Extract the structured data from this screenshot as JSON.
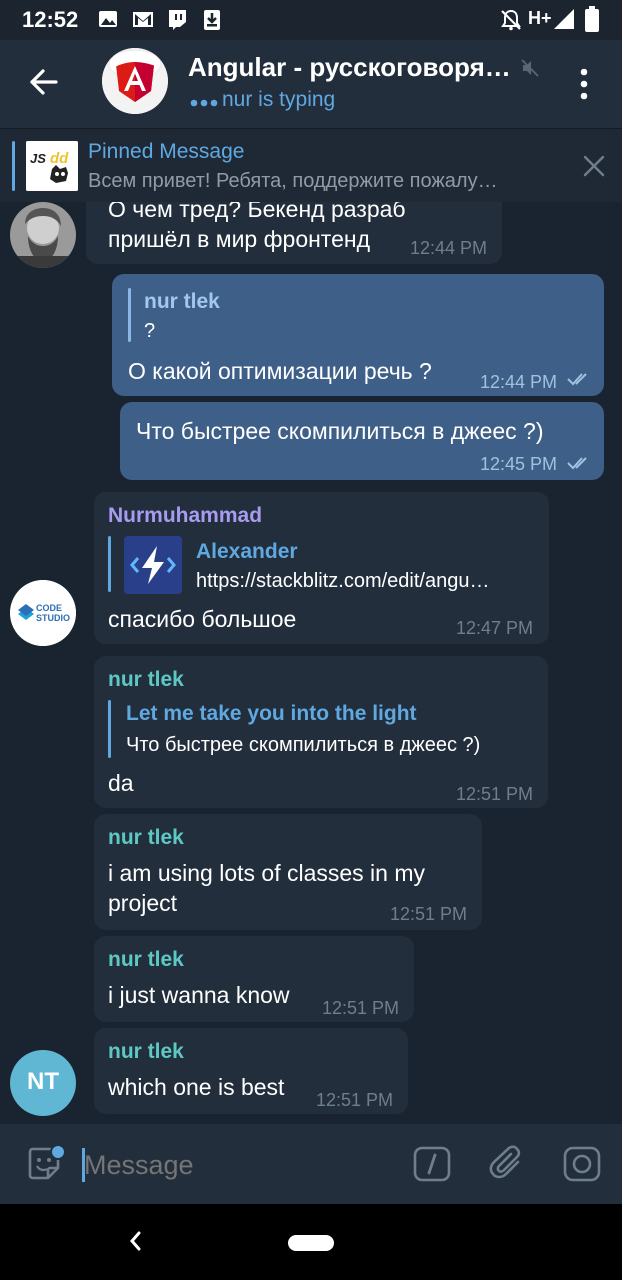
{
  "status_bar": {
    "time": "12:52",
    "network": "H+"
  },
  "header": {
    "title": "Angular - русскоговоря…",
    "subtitle": "nur is typing"
  },
  "pinned": {
    "title": "Pinned Message",
    "text": "Всем привет! Ребята, поддержите пожалу…",
    "thumb_text": "JS dd"
  },
  "messages": [
    {
      "dir": "in",
      "text": "О чем тред? Бекенд разраб пришёл в мир фронтенд",
      "time": "12:44 PM"
    },
    {
      "dir": "out",
      "reply_name": "nur tlek",
      "reply_text": "?",
      "text": "О какой оптимизации речь ?",
      "time": "12:44 PM"
    },
    {
      "dir": "out",
      "text": "Что быстрее скомпилиться в джеес ?)",
      "time": "12:45 PM"
    },
    {
      "dir": "in",
      "sender": "Nurmuhammad",
      "reply_name": "Alexander",
      "reply_text": "https://stackblitz.com/edit/angu…",
      "text": "спасибо большое",
      "time": "12:47 PM"
    },
    {
      "dir": "in",
      "sender": "nur tlek",
      "reply_name": "Let me take you into the light",
      "reply_text": "Что быстрее скомпилиться в джеес ?)",
      "text": "da",
      "time": "12:51 PM"
    },
    {
      "dir": "in",
      "sender": "nur tlek",
      "text": "i am using lots of classes in my project",
      "time": "12:51 PM"
    },
    {
      "dir": "in",
      "sender": "nur tlek",
      "text": "i just wanna know",
      "time": "12:51 PM"
    },
    {
      "dir": "in",
      "sender": "nur tlek",
      "text": "which one is best",
      "time": "12:51 PM"
    }
  ],
  "avatars": {
    "code_studio": {
      "line1": "CODE",
      "line2": "STUDIO"
    },
    "nur_tlek_initials": "NT"
  },
  "composer": {
    "placeholder": "Message"
  },
  "colors": {
    "background": "#1a2330",
    "header": "#232e3c",
    "incoming_bubble": "#232e3c",
    "outgoing_bubble": "#3e6088",
    "accent": "#5fa8e0",
    "sender_teal": "#5ec9c4",
    "sender_violet": "#a89bf0"
  }
}
